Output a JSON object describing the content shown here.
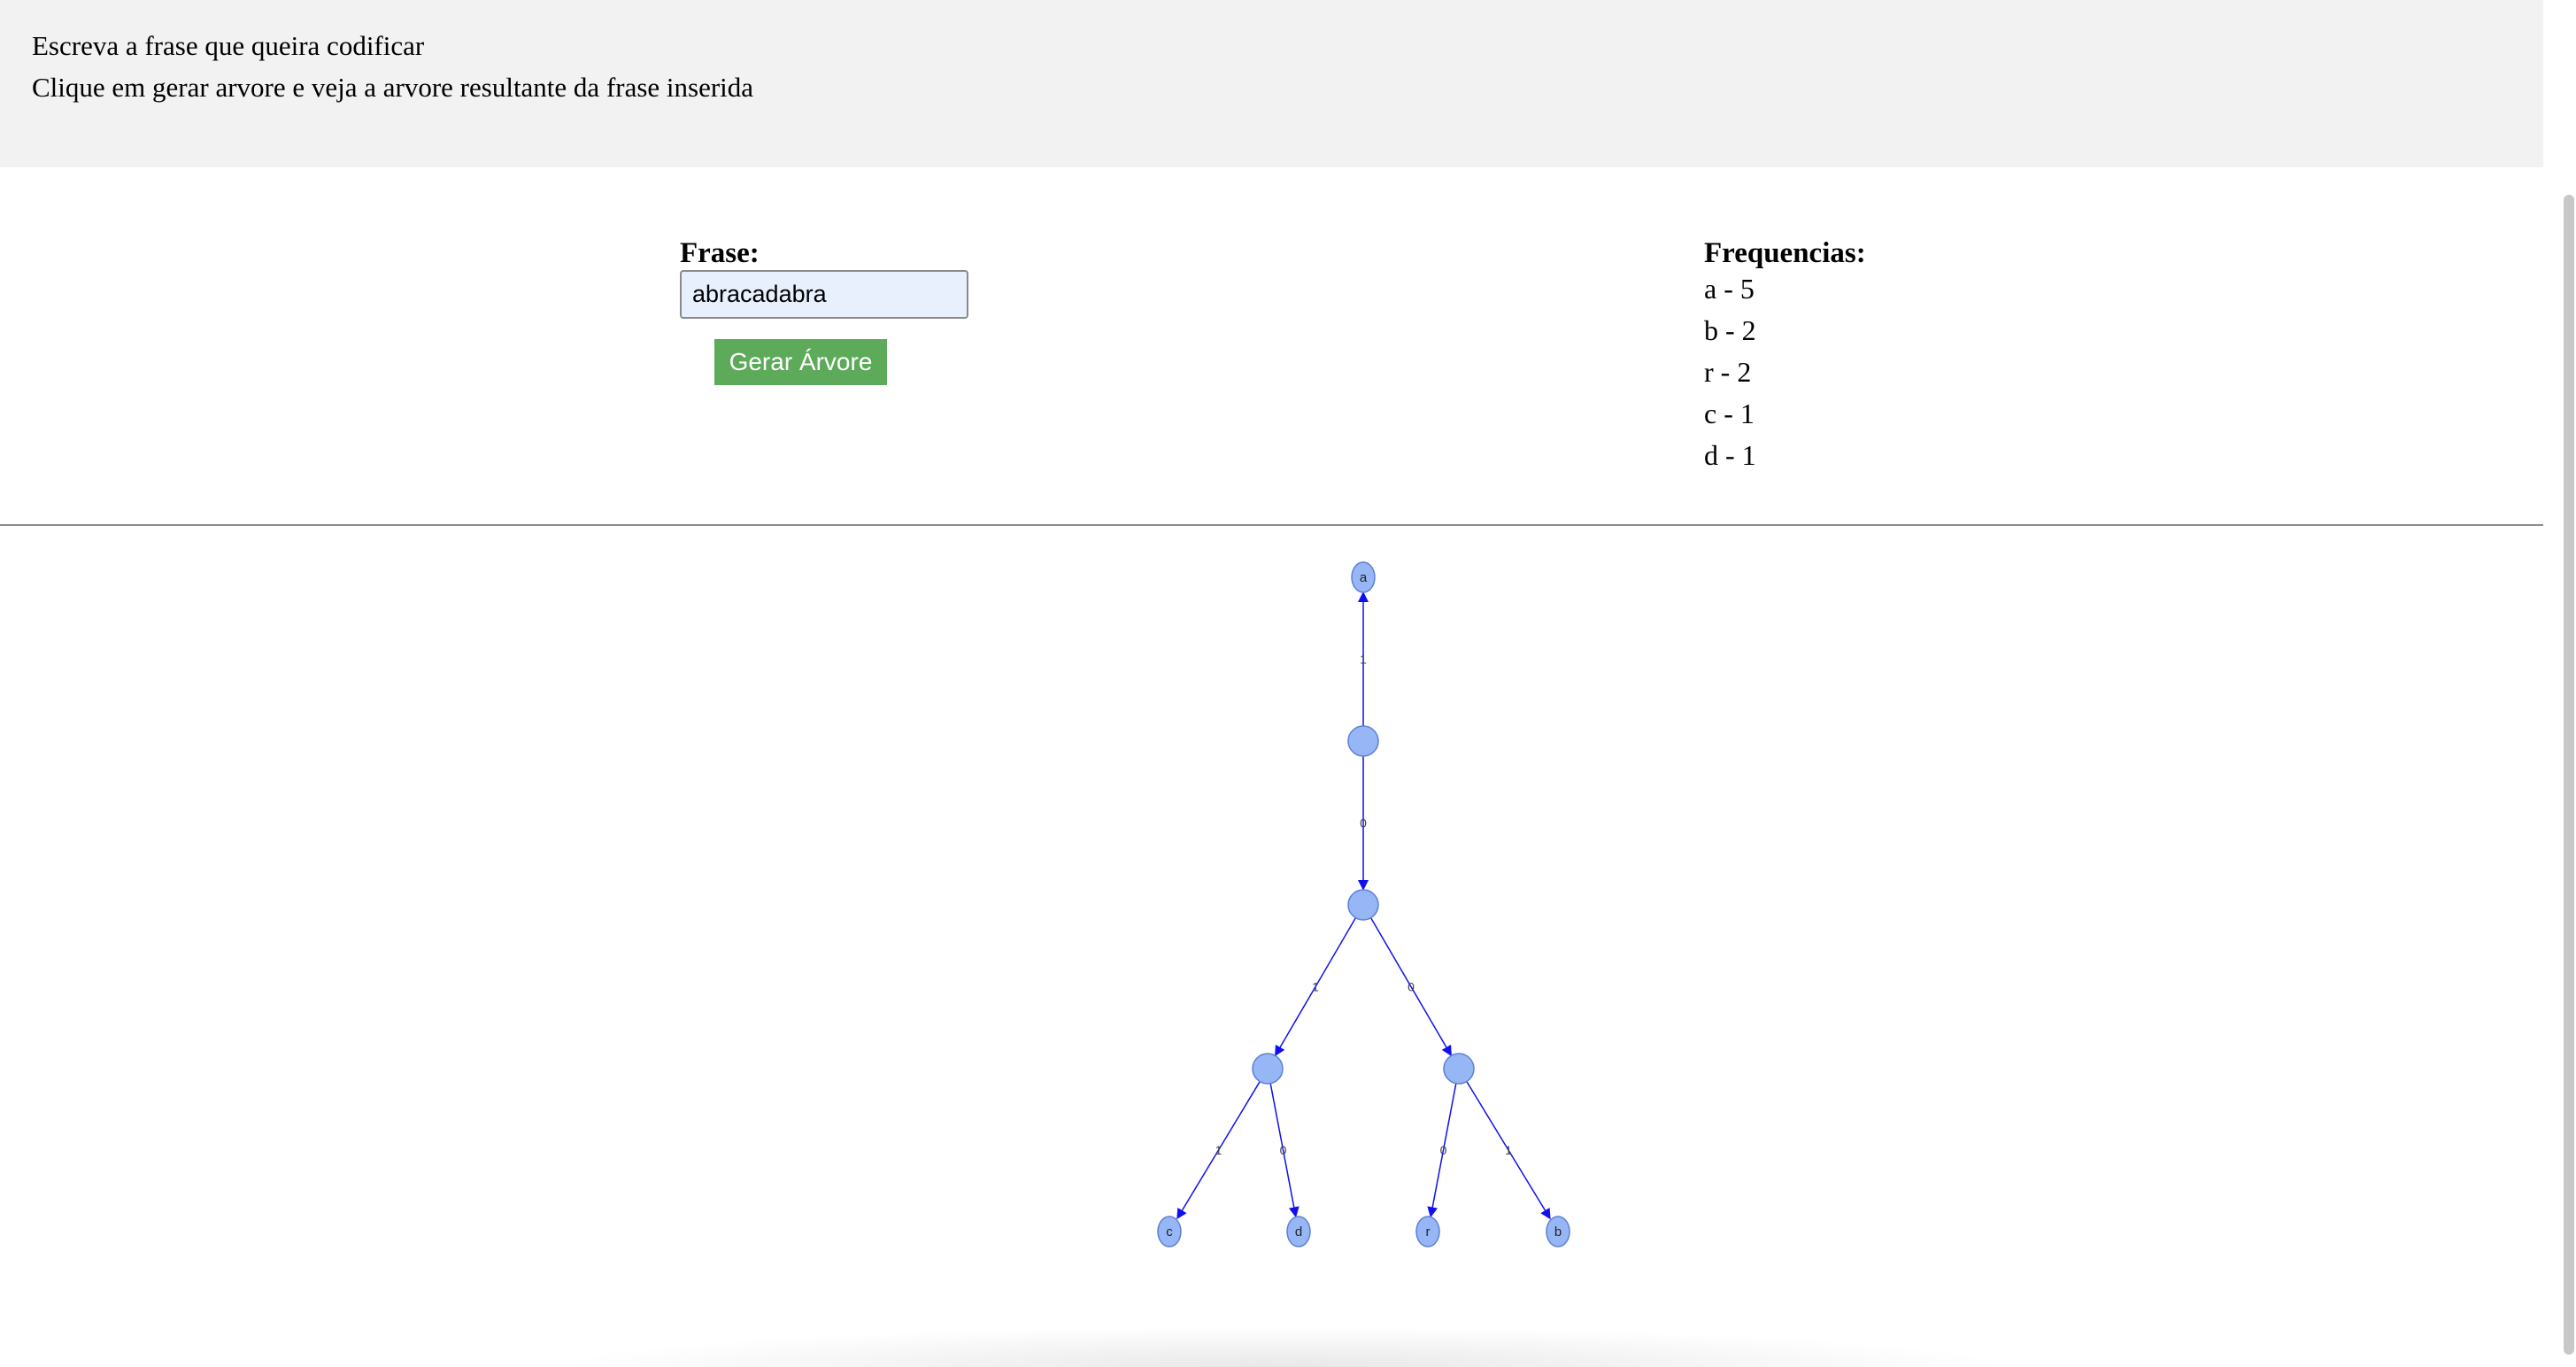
{
  "header": {
    "line1": "Escreva a frase que queira codificar",
    "line2": "Clique em gerar arvore e veja a arvore resultante da frase inserida"
  },
  "form": {
    "frase_label": "Frase:",
    "phrase_value": "abracadabra",
    "button_label": "Gerar Árvore"
  },
  "frequencies": {
    "title": "Frequencias:",
    "items": [
      "a - 5",
      "b - 2",
      "r - 2",
      "c - 1",
      "d - 1"
    ]
  },
  "tree": {
    "colors": {
      "node_fill": "#97b6f5",
      "node_stroke": "#5d7fd4",
      "edge": "#1010ee"
    },
    "nodes": [
      {
        "id": "leaf-a",
        "label": "a"
      },
      {
        "id": "n1",
        "label": ""
      },
      {
        "id": "n2",
        "label": ""
      },
      {
        "id": "n3",
        "label": ""
      },
      {
        "id": "n4",
        "label": ""
      },
      {
        "id": "leaf-c",
        "label": "c"
      },
      {
        "id": "leaf-d",
        "label": "d"
      },
      {
        "id": "leaf-r",
        "label": "r"
      },
      {
        "id": "leaf-b",
        "label": "b"
      }
    ],
    "edges": [
      {
        "from": "n1",
        "to": "leaf-a",
        "label": "1"
      },
      {
        "from": "n1",
        "to": "n2",
        "label": "0"
      },
      {
        "from": "n2",
        "to": "n3",
        "label": "1"
      },
      {
        "from": "n2",
        "to": "n4",
        "label": "0"
      },
      {
        "from": "n3",
        "to": "leaf-c",
        "label": "1"
      },
      {
        "from": "n3",
        "to": "leaf-d",
        "label": "0"
      },
      {
        "from": "n4",
        "to": "leaf-r",
        "label": "0"
      },
      {
        "from": "n4",
        "to": "leaf-b",
        "label": "1"
      }
    ]
  }
}
